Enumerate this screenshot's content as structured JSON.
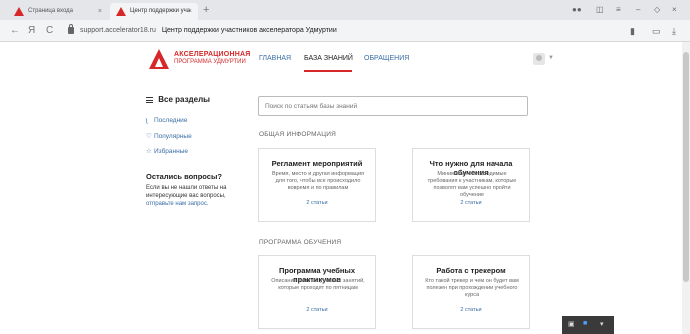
{
  "browser": {
    "tabs": [
      {
        "label": "Страница входа"
      },
      {
        "label": "Центр поддержки уча"
      }
    ],
    "new_tab": "+",
    "url_domain": "support.accelerator18.ru",
    "url_title": "Центр поддержки участников акселератора Удмуртии",
    "nav": {
      "back": "←",
      "browser_logo": "Я",
      "reload": "C"
    }
  },
  "header": {
    "logo_line1": "АКСЕЛЕРАЦИОННАЯ",
    "logo_line2": "ПРОГРАММА УДМУРТИИ",
    "nav": [
      {
        "label": "ГЛАВНАЯ"
      },
      {
        "label": "БАЗА ЗНАНИЙ"
      },
      {
        "label": "ОБРАЩЕНИЯ"
      }
    ],
    "active_nav": "БАЗА ЗНАНИЙ"
  },
  "sidebar": {
    "title": "Все разделы",
    "links": [
      {
        "icon": "rss-icon",
        "label": "Последние"
      },
      {
        "icon": "heart-icon",
        "label": "Популярные"
      },
      {
        "icon": "star-icon",
        "label": "Избранные"
      }
    ],
    "question_title": "Остались вопросы?",
    "question_text": "Если вы не нашли ответы на интересующие вас вопросы,",
    "question_link": "отправьте нам запрос."
  },
  "main": {
    "search_placeholder": "Поиск по статьям базы знаний",
    "sections": [
      {
        "label": "ОБЩАЯ ИНФОРМАЦИЯ",
        "cards": [
          {
            "title": "Регламент мероприятий",
            "desc": "Время, место и другая информация для того, чтобы все происходило вовремя и по правилам",
            "count": "2 статьи"
          },
          {
            "title": "Что нужно для начала обучения",
            "desc": "Минимально необходимые требования к участникам, которые позволят вам успешно пройти обучение",
            "count": "2 статьи"
          }
        ]
      },
      {
        "label": "ПРОГРАММА ОБУЧЕНИЯ",
        "cards": [
          {
            "title": "Программа учебных практикумов",
            "desc": "Описание тематик учебных занятий, которые проходят по пятницам",
            "count": "2 статьи"
          },
          {
            "title": "Работа с трекером",
            "desc": "Кто такой трекер и чем он будет вам полезен при прохождении учебного курса",
            "count": "2 статьи"
          }
        ]
      }
    ]
  },
  "colors": {
    "brand": "#d62828",
    "link": "#3a6ea5"
  }
}
